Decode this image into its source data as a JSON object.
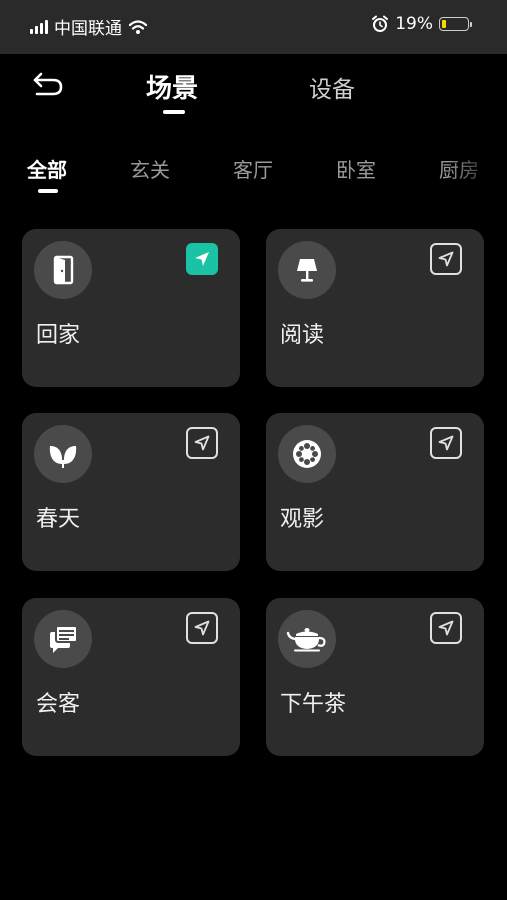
{
  "status_bar": {
    "carrier": "中国联通",
    "battery_percent_text": "19%",
    "battery_level": 0.19
  },
  "header": {
    "tabs": [
      {
        "label": "场景",
        "active": true
      },
      {
        "label": "设备",
        "active": false
      }
    ]
  },
  "room_tabs": [
    {
      "label": "全部",
      "active": true
    },
    {
      "label": "玄关"
    },
    {
      "label": "客厅"
    },
    {
      "label": "卧室"
    },
    {
      "label": "厨房"
    }
  ],
  "scenes": [
    {
      "label": "回家",
      "icon": "door-icon",
      "sent": true
    },
    {
      "label": "阅读",
      "icon": "lamp-icon",
      "sent": false
    },
    {
      "label": "春天",
      "icon": "sprout-icon",
      "sent": false
    },
    {
      "label": "观影",
      "icon": "film-reel-icon",
      "sent": false
    },
    {
      "label": "会客",
      "icon": "chat-icon",
      "sent": false
    },
    {
      "label": "下午茶",
      "icon": "teapot-icon",
      "sent": false
    }
  ],
  "colors": {
    "accent": "#19c3a3",
    "card_bg": "#2c2c2c",
    "background": "#000000"
  }
}
